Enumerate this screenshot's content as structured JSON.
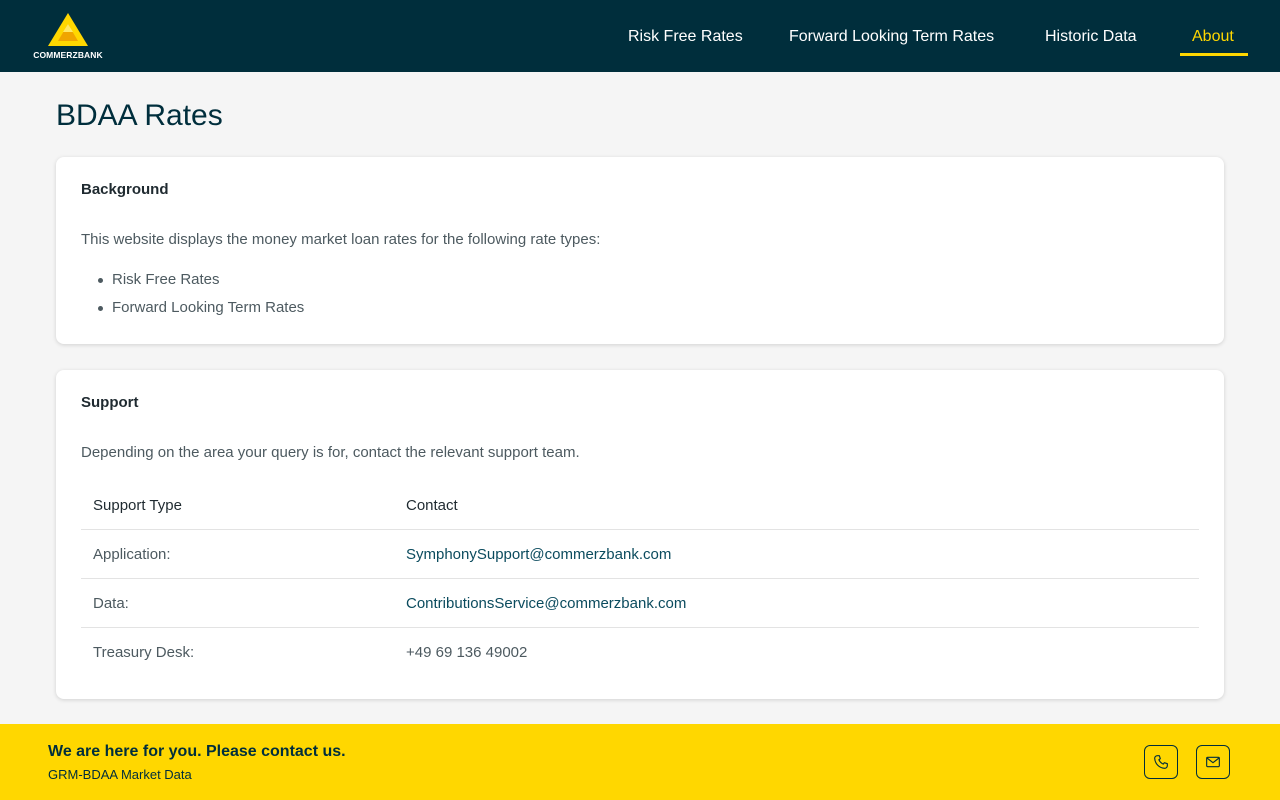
{
  "brand": {
    "logo_text": "COMMERZBANK"
  },
  "nav": {
    "items": [
      {
        "label": "Risk Free Rates"
      },
      {
        "label": "Forward Looking Term Rates"
      },
      {
        "label": "Historic Data"
      },
      {
        "label": "About"
      }
    ],
    "active": "About"
  },
  "page": {
    "title": "BDAA Rates"
  },
  "background": {
    "title": "Background",
    "text": "This website displays the money market loan rates for the following rate types:",
    "items": [
      "Risk Free Rates",
      "Forward Looking Term Rates"
    ]
  },
  "support": {
    "title": "Support",
    "text": "Depending on the area your query is for, contact the relevant support team.",
    "headers": [
      "Support Type",
      "Contact"
    ],
    "rows": [
      {
        "type": "Application:",
        "contact": "SymphonySupport@commerzbank.com"
      },
      {
        "type": "Data:",
        "contact": "ContributionsService@commerzbank.com"
      },
      {
        "type": "Treasury Desk:",
        "contact": "+49 69 136 49002"
      }
    ]
  },
  "footer": {
    "title": "We are here for you. Please contact us.",
    "subtitle": "GRM-BDAA Market Data",
    "icons": [
      "phone-icon",
      "mail-icon"
    ]
  },
  "colors": {
    "header_bg": "#002e3c",
    "accent": "#ffd700",
    "link": "#0b4b5e"
  }
}
